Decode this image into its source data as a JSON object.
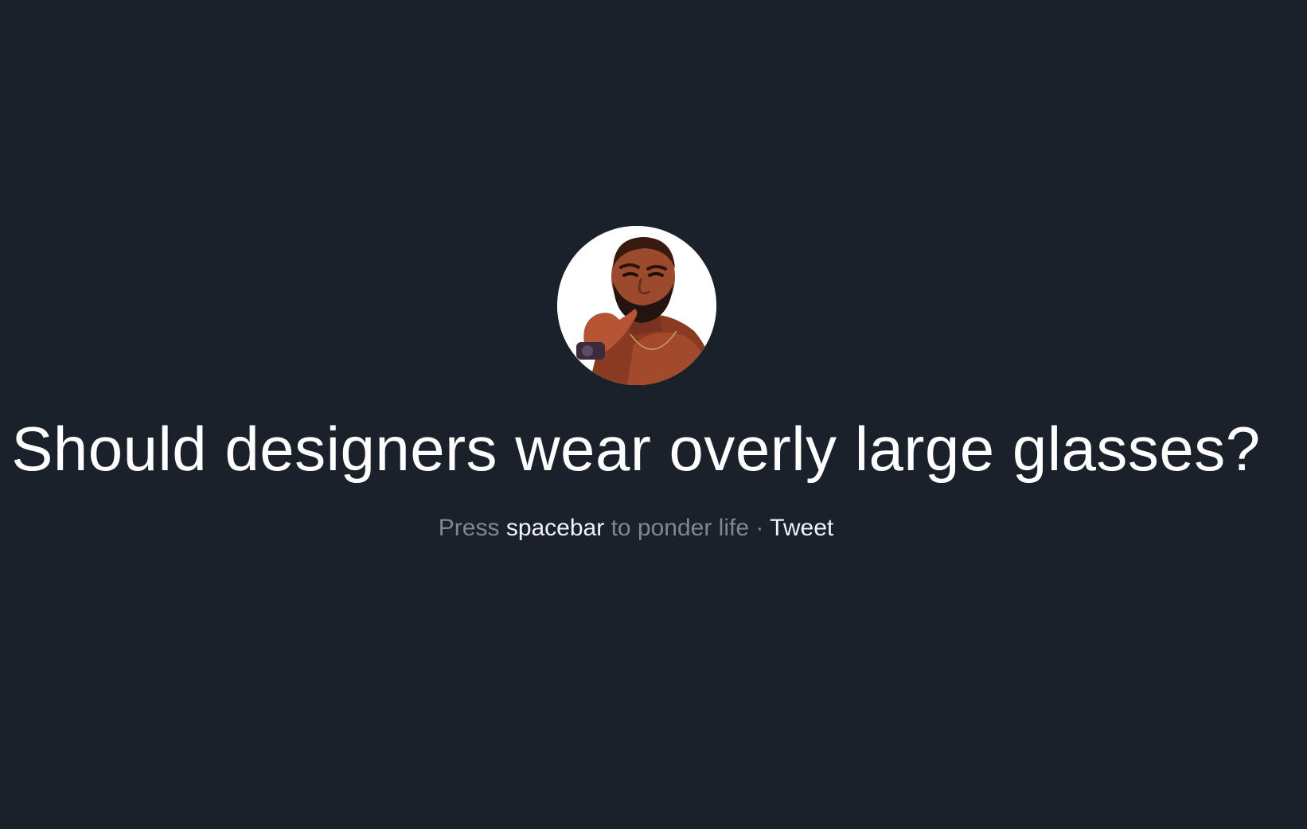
{
  "avatar": {
    "alt": "DJ Khaled thinking"
  },
  "question": "Should designers wear overly large glasses?",
  "hint": {
    "press": "Press",
    "key": "spacebar",
    "action": "to ponder life",
    "separator": "·",
    "tweet": "Tweet"
  },
  "colors": {
    "background": "#1b212a",
    "question_text": "#ffffff",
    "muted_text": "#7d8795",
    "highlight_text": "#f2f4f7"
  }
}
